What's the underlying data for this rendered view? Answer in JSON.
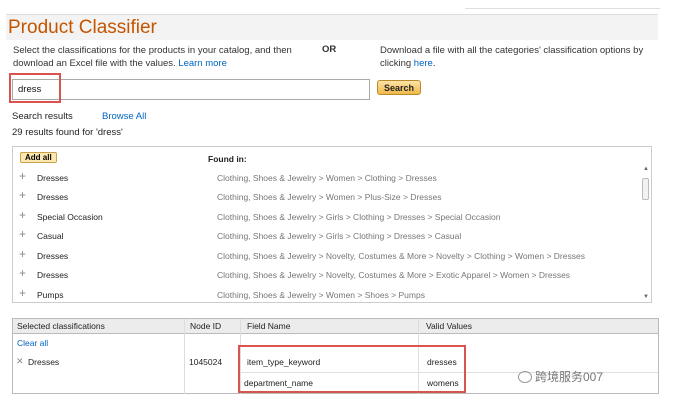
{
  "page": {
    "title": "Product Classifier",
    "intro_left": "Select the classifications for the products in your catalog, and then download an Excel file with the values.",
    "learn_more": "Learn more",
    "or": "OR",
    "intro_right": "Download a file with all the categories' classification options by clicking",
    "here": "here",
    "here_suffix": "."
  },
  "search": {
    "value": "dress",
    "button": "Search"
  },
  "results_header": {
    "label": "Search results",
    "browse_all": "Browse All",
    "count": "29 results found for 'dress'"
  },
  "results": {
    "add_all": "Add all",
    "found_in": "Found in:",
    "rows": [
      {
        "name": "Dresses",
        "path": "Clothing, Shoes & Jewelry > Women > Clothing > Dresses"
      },
      {
        "name": "Dresses",
        "path": "Clothing, Shoes & Jewelry > Women > Plus-Size > Dresses"
      },
      {
        "name": "Special Occasion",
        "path": "Clothing, Shoes & Jewelry > Girls > Clothing > Dresses > Special Occasion"
      },
      {
        "name": "Casual",
        "path": "Clothing, Shoes & Jewelry > Girls > Clothing > Dresses > Casual"
      },
      {
        "name": "Dresses",
        "path": "Clothing, Shoes & Jewelry > Novelty, Costumes & More > Novelty > Clothing > Women > Dresses"
      },
      {
        "name": "Dresses",
        "path": "Clothing, Shoes & Jewelry > Novelty, Costumes & More > Exotic Apparel > Women > Dresses"
      },
      {
        "name": "Pumps",
        "path": "Clothing, Shoes & Jewelry > Women > Shoes > Pumps"
      }
    ]
  },
  "selected": {
    "headers": [
      "Selected classifications",
      "Node ID",
      "Field Name",
      "Valid Values"
    ],
    "clear_all": "Clear all",
    "item": {
      "name": "Dresses",
      "node_id": "1045024",
      "fields": [
        {
          "name": "item_type_keyword",
          "value": "dresses"
        },
        {
          "name": "department_name",
          "value": "womens"
        }
      ]
    }
  },
  "watermark": "跨境服务007",
  "icons": {
    "expand": "plus-icon",
    "remove": "close-icon",
    "watermark": "wechat-icon"
  },
  "colors": {
    "title": "#c45500",
    "link": "#0066c0",
    "highlight": "#d9534f",
    "button": "#f0b849"
  }
}
